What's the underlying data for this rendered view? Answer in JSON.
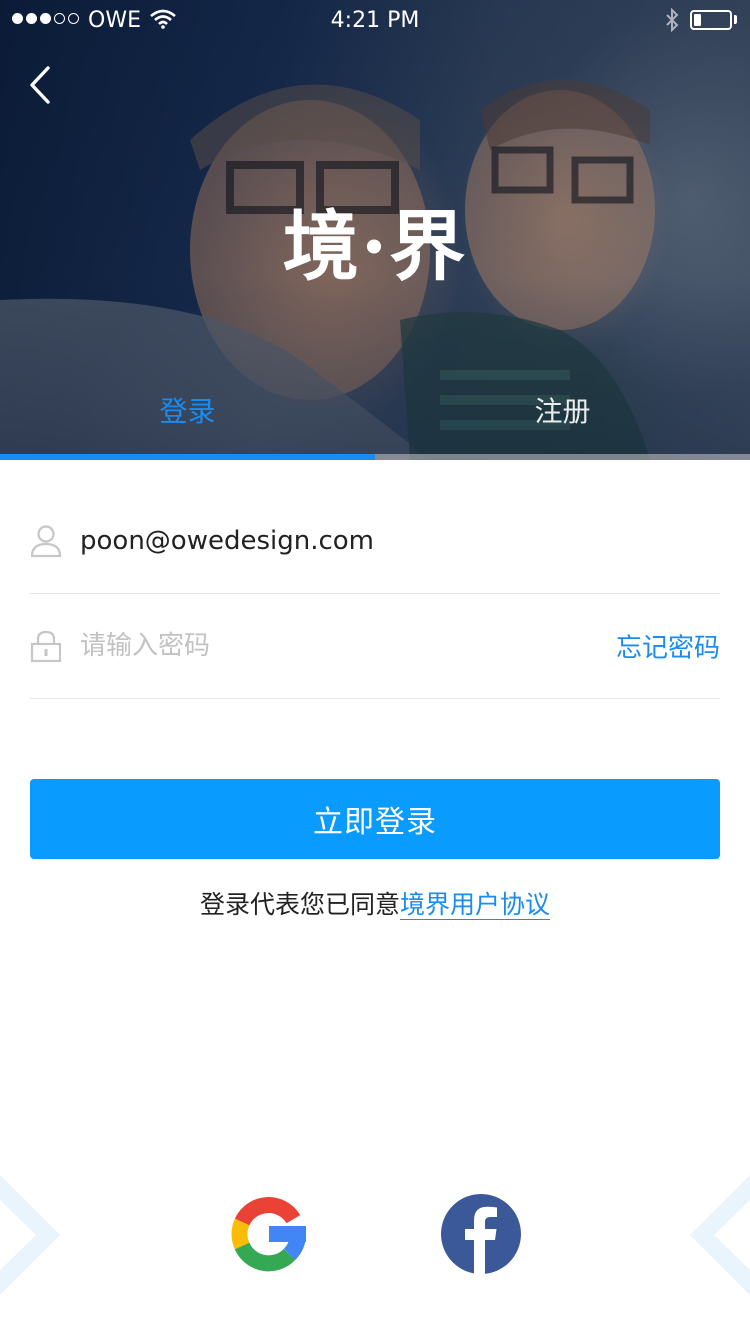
{
  "status_bar": {
    "carrier": "OWE",
    "time": "4:21 PM",
    "signal_bars_filled": 3,
    "signal_bars_total": 5,
    "battery_level": 0.2
  },
  "header": {
    "logo_text": "境·界",
    "back_icon": "chevron-left-icon"
  },
  "tabs": [
    {
      "label": "登录",
      "active": true
    },
    {
      "label": "注册",
      "active": false
    }
  ],
  "form": {
    "email_value": "poon@owedesign.com",
    "password_placeholder": "请输入密码",
    "forgot_label": "忘记密码",
    "login_label": "立即登录"
  },
  "agreement": {
    "prefix": "登录代表您已同意",
    "link": "境界用户协议"
  },
  "social": {
    "google_icon": "google-icon",
    "facebook_icon": "facebook-icon"
  },
  "colors": {
    "accent": "#0a9bff",
    "link": "#1a8cf0",
    "facebook": "#3b5998"
  }
}
